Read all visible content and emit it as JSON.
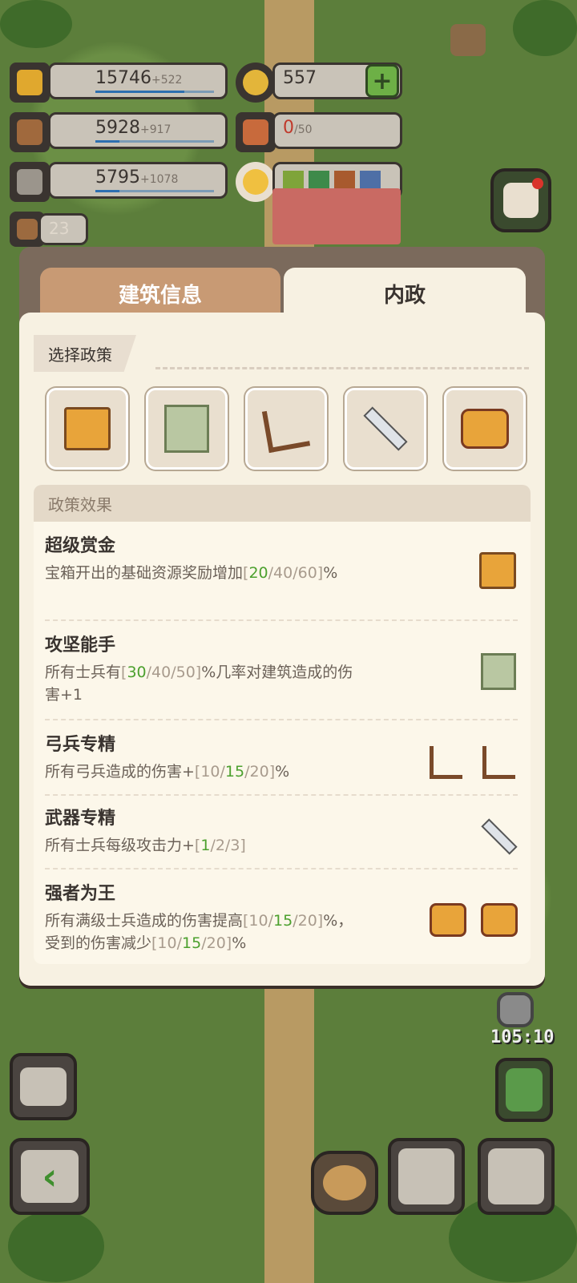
{
  "resources": {
    "food": {
      "value": "15746",
      "inc": "+522",
      "fill": 0.75
    },
    "wood": {
      "value": "5928",
      "inc": "+917",
      "fill": 0.2
    },
    "stone": {
      "value": "5795",
      "inc": "+1078",
      "fill": 0.2
    },
    "coin": {
      "value": "557"
    },
    "gift": {
      "current": "0",
      "max": "/50"
    },
    "book": {
      "value": "23"
    }
  },
  "tabs": {
    "building_info": "建筑信息",
    "internal_affairs": "内政"
  },
  "select_policy": "选择政策",
  "effects_header": "政策效果",
  "policies": [
    {
      "title": "超级赏金",
      "desc_a": "宝箱开出的基础资源奖励增加",
      "desc_b": "[",
      "v1": "20",
      "desc_c": "/40/60]",
      "desc_d": "%"
    },
    {
      "title": "攻坚能手",
      "desc_a": "所有士兵有",
      "desc_b": "[",
      "v1": "30",
      "desc_c": "/40/50]",
      "desc_d": "%几率对建筑造成的伤害+1"
    },
    {
      "title": "弓兵专精",
      "desc_a": "所有弓兵造成的伤害+",
      "desc_b": "[10/",
      "v1": "15",
      "desc_c": "/20]",
      "desc_d": "%"
    },
    {
      "title": "武器专精",
      "desc_a": "所有士兵每级攻击力+",
      "desc_b": "[",
      "v1": "1",
      "desc_c": "/2/3]",
      "desc_d": ""
    },
    {
      "title": "强者为王",
      "desc_a": "所有满级士兵造成的伤害提高",
      "desc_b": "[10/",
      "v1": "15",
      "desc_c": "/20]",
      "desc_d": "%，受到的伤害减少",
      "desc_e": "[10/",
      "v2": "15",
      "desc_f": "/20]",
      "desc_g": "%"
    }
  ],
  "timer": "105:10",
  "colors": {
    "highlight": "#4ca02e",
    "gift_red": "#c0392b",
    "plus_green": "#6db046"
  }
}
